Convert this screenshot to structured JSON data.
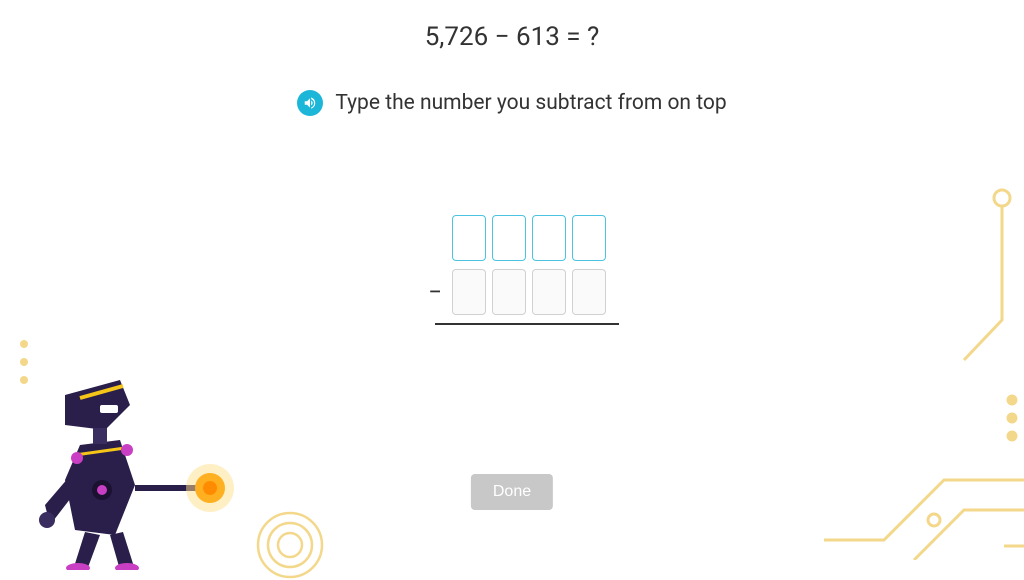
{
  "question": "5,726 − 613 = ?",
  "instruction": "Type the number you subtract from on top",
  "minus": "−",
  "done_label": "Done",
  "top_row": {
    "d1": "",
    "d2": "",
    "d3": "",
    "d4": ""
  },
  "bottom_row": {
    "d1": "",
    "d2": "",
    "d3": "",
    "d4": ""
  }
}
